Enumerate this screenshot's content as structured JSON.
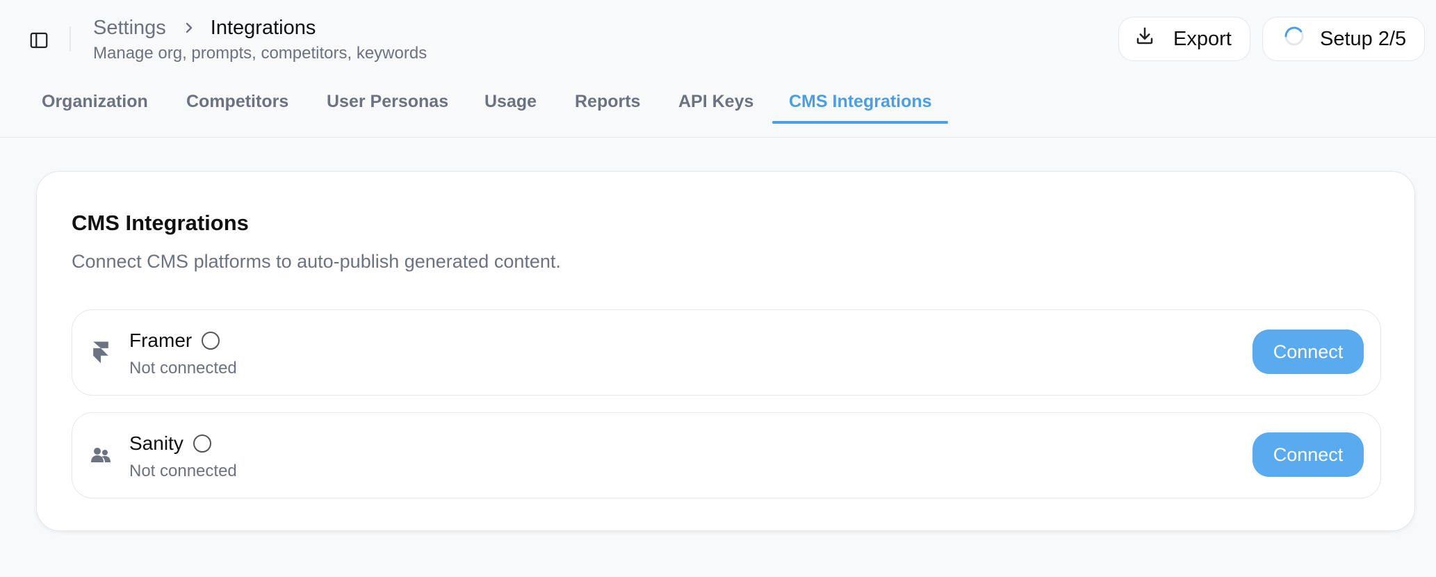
{
  "header": {
    "breadcrumb_parent": "Settings",
    "breadcrumb_current": "Integrations",
    "subtitle": "Manage org, prompts, competitors, keywords",
    "export_label": "Export",
    "setup_label": "Setup 2/5",
    "setup_progress": 0.4
  },
  "tabs": [
    {
      "label": "Organization"
    },
    {
      "label": "Competitors"
    },
    {
      "label": "User Personas"
    },
    {
      "label": "Usage"
    },
    {
      "label": "Reports"
    },
    {
      "label": "API Keys"
    },
    {
      "label": "CMS Integrations",
      "active": true
    }
  ],
  "card": {
    "title": "CMS Integrations",
    "description": "Connect CMS platforms to auto-publish generated content.",
    "integrations": [
      {
        "name": "Framer",
        "status": "Not connected",
        "action": "Connect",
        "icon": "framer-icon"
      },
      {
        "name": "Sanity",
        "status": "Not connected",
        "action": "Connect",
        "icon": "users-icon"
      }
    ]
  },
  "colors": {
    "accent": "#4a9ee6",
    "button": "#5aaaf0",
    "muted_text": "#6b7280",
    "border": "#e5e7eb",
    "page_bg": "#f8f9fb"
  }
}
